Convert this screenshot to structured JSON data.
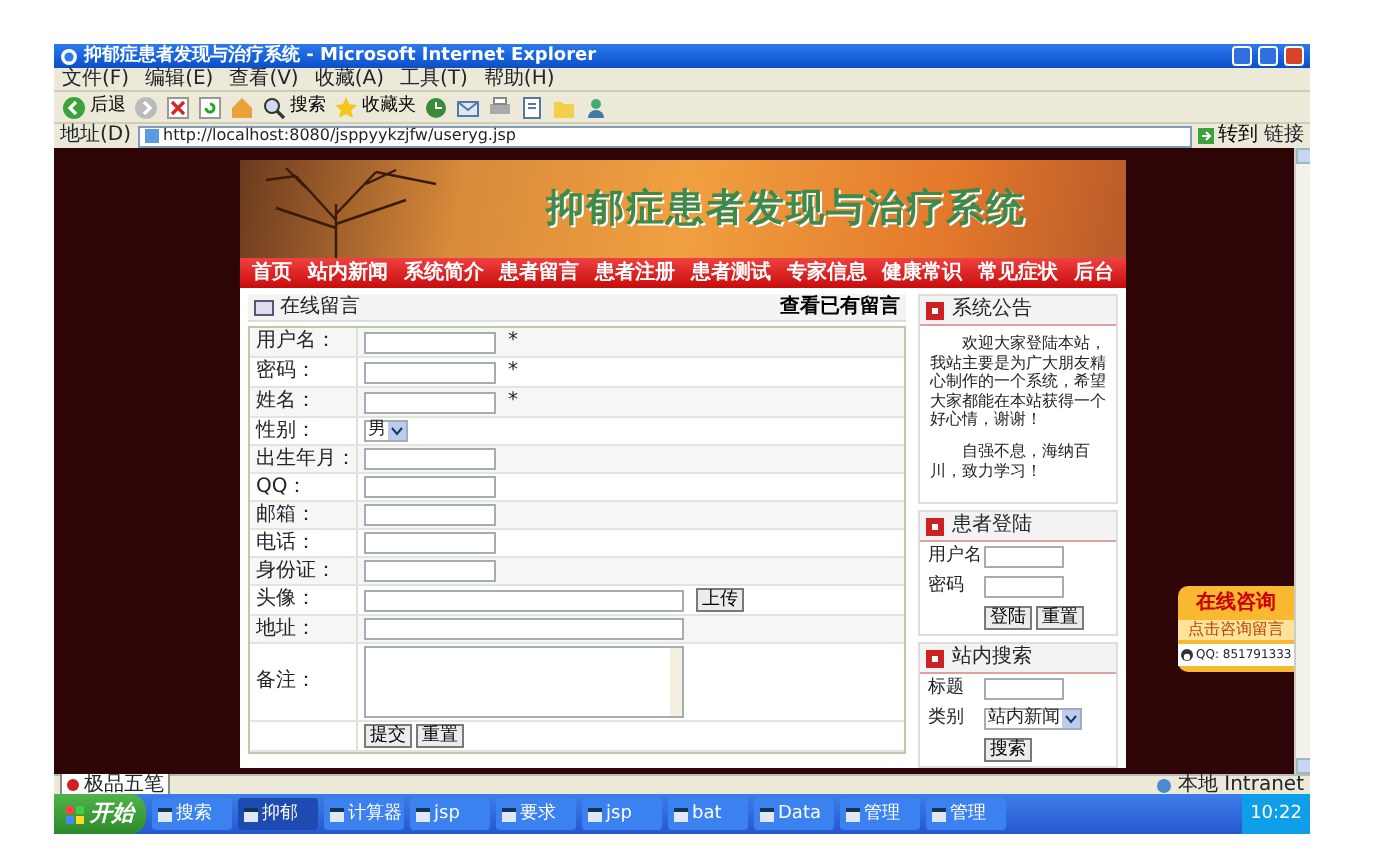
{
  "window": {
    "title": "抑郁症患者发现与治疗系统 - Microsoft Internet Explorer"
  },
  "menu": [
    "文件(F)",
    "编辑(E)",
    "查看(V)",
    "收藏(A)",
    "工具(T)",
    "帮助(H)"
  ],
  "toolbar": [
    {
      "kind": "back",
      "label": "后退"
    },
    {
      "kind": "forward"
    },
    {
      "kind": "stop"
    },
    {
      "kind": "refresh"
    },
    {
      "kind": "home"
    },
    {
      "kind": "search",
      "label": "搜索"
    },
    {
      "kind": "favorites",
      "label": "收藏夹"
    },
    {
      "kind": "history"
    },
    {
      "kind": "mail"
    },
    {
      "kind": "print"
    },
    {
      "kind": "edit"
    },
    {
      "kind": "folder"
    },
    {
      "kind": "messenger"
    }
  ],
  "address": {
    "label": "地址(D)",
    "value": "http://localhost:8080/jsppyykzjfw/useryg.jsp",
    "go": "转到",
    "links": "链接"
  },
  "site": {
    "banner_title": "抑郁症患者发现与治疗系统",
    "nav": [
      "首页",
      "站内新闻",
      "系统简介",
      "患者留言",
      "患者注册",
      "患者测试",
      "专家信息",
      "健康常识",
      "常见症状",
      "后台"
    ],
    "panel_title": "在线留言",
    "panel_link": "查看已有留言",
    "form": [
      {
        "label": "用户名：",
        "kind": "text",
        "mark": "*"
      },
      {
        "label": "密码：",
        "kind": "text",
        "mark": "*"
      },
      {
        "label": "姓名：",
        "kind": "text",
        "mark": "*"
      },
      {
        "label": "性别：",
        "kind": "select",
        "value": "男"
      },
      {
        "label": "出生年月：",
        "kind": "text"
      },
      {
        "label": "QQ：",
        "kind": "text"
      },
      {
        "label": "邮箱：",
        "kind": "text"
      },
      {
        "label": "电话：",
        "kind": "text"
      },
      {
        "label": "身份证：",
        "kind": "text"
      },
      {
        "label": "头像：",
        "kind": "file",
        "button": "上传"
      },
      {
        "label": "地址：",
        "kind": "wide"
      },
      {
        "label": "备注：",
        "kind": "textarea"
      }
    ],
    "form_buttons": [
      "提交",
      "重置"
    ]
  },
  "sidebar": [
    {
      "kind": "notice",
      "title": "系统公告",
      "paragraphs": [
        "欢迎大家登陆本站，我站主要是为广大朋友精心制作的一个系统，希望大家都能在本站获得一个好心情，谢谢！",
        "自强不息，海纳百川，致力学习！"
      ]
    },
    {
      "kind": "login",
      "title": "患者登陆",
      "fields": [
        {
          "label": "用户名",
          "kind": "text"
        },
        {
          "label": "密码",
          "kind": "text"
        }
      ],
      "buttons": [
        "登陆",
        "重置"
      ]
    },
    {
      "kind": "search",
      "title": "站内搜索",
      "fields": [
        {
          "label": "标题",
          "kind": "text"
        },
        {
          "label": "类别",
          "kind": "select",
          "value": "站内新闻"
        }
      ],
      "buttons": [
        "搜索"
      ]
    }
  ],
  "float_widget": {
    "title": "在线咨询",
    "link": "点击咨询留言",
    "qq": "QQ: 851791333"
  },
  "status_bar": {
    "ime": "极品五笔",
    "zone": "本地 Intranet"
  },
  "taskbar": {
    "start": "开始",
    "tasks": [
      {
        "label": "搜索",
        "selected": false
      },
      {
        "label": "抑郁",
        "selected": true
      },
      {
        "label": "计算器",
        "selected": false
      },
      {
        "label": "jsp",
        "selected": false
      },
      {
        "label": "要求",
        "selected": false
      },
      {
        "label": "jsp",
        "selected": false
      },
      {
        "label": "bat",
        "selected": false
      },
      {
        "label": "Data",
        "selected": false
      },
      {
        "label": "管理",
        "selected": false
      },
      {
        "label": "管理",
        "selected": false
      }
    ],
    "clock": "10:22"
  }
}
